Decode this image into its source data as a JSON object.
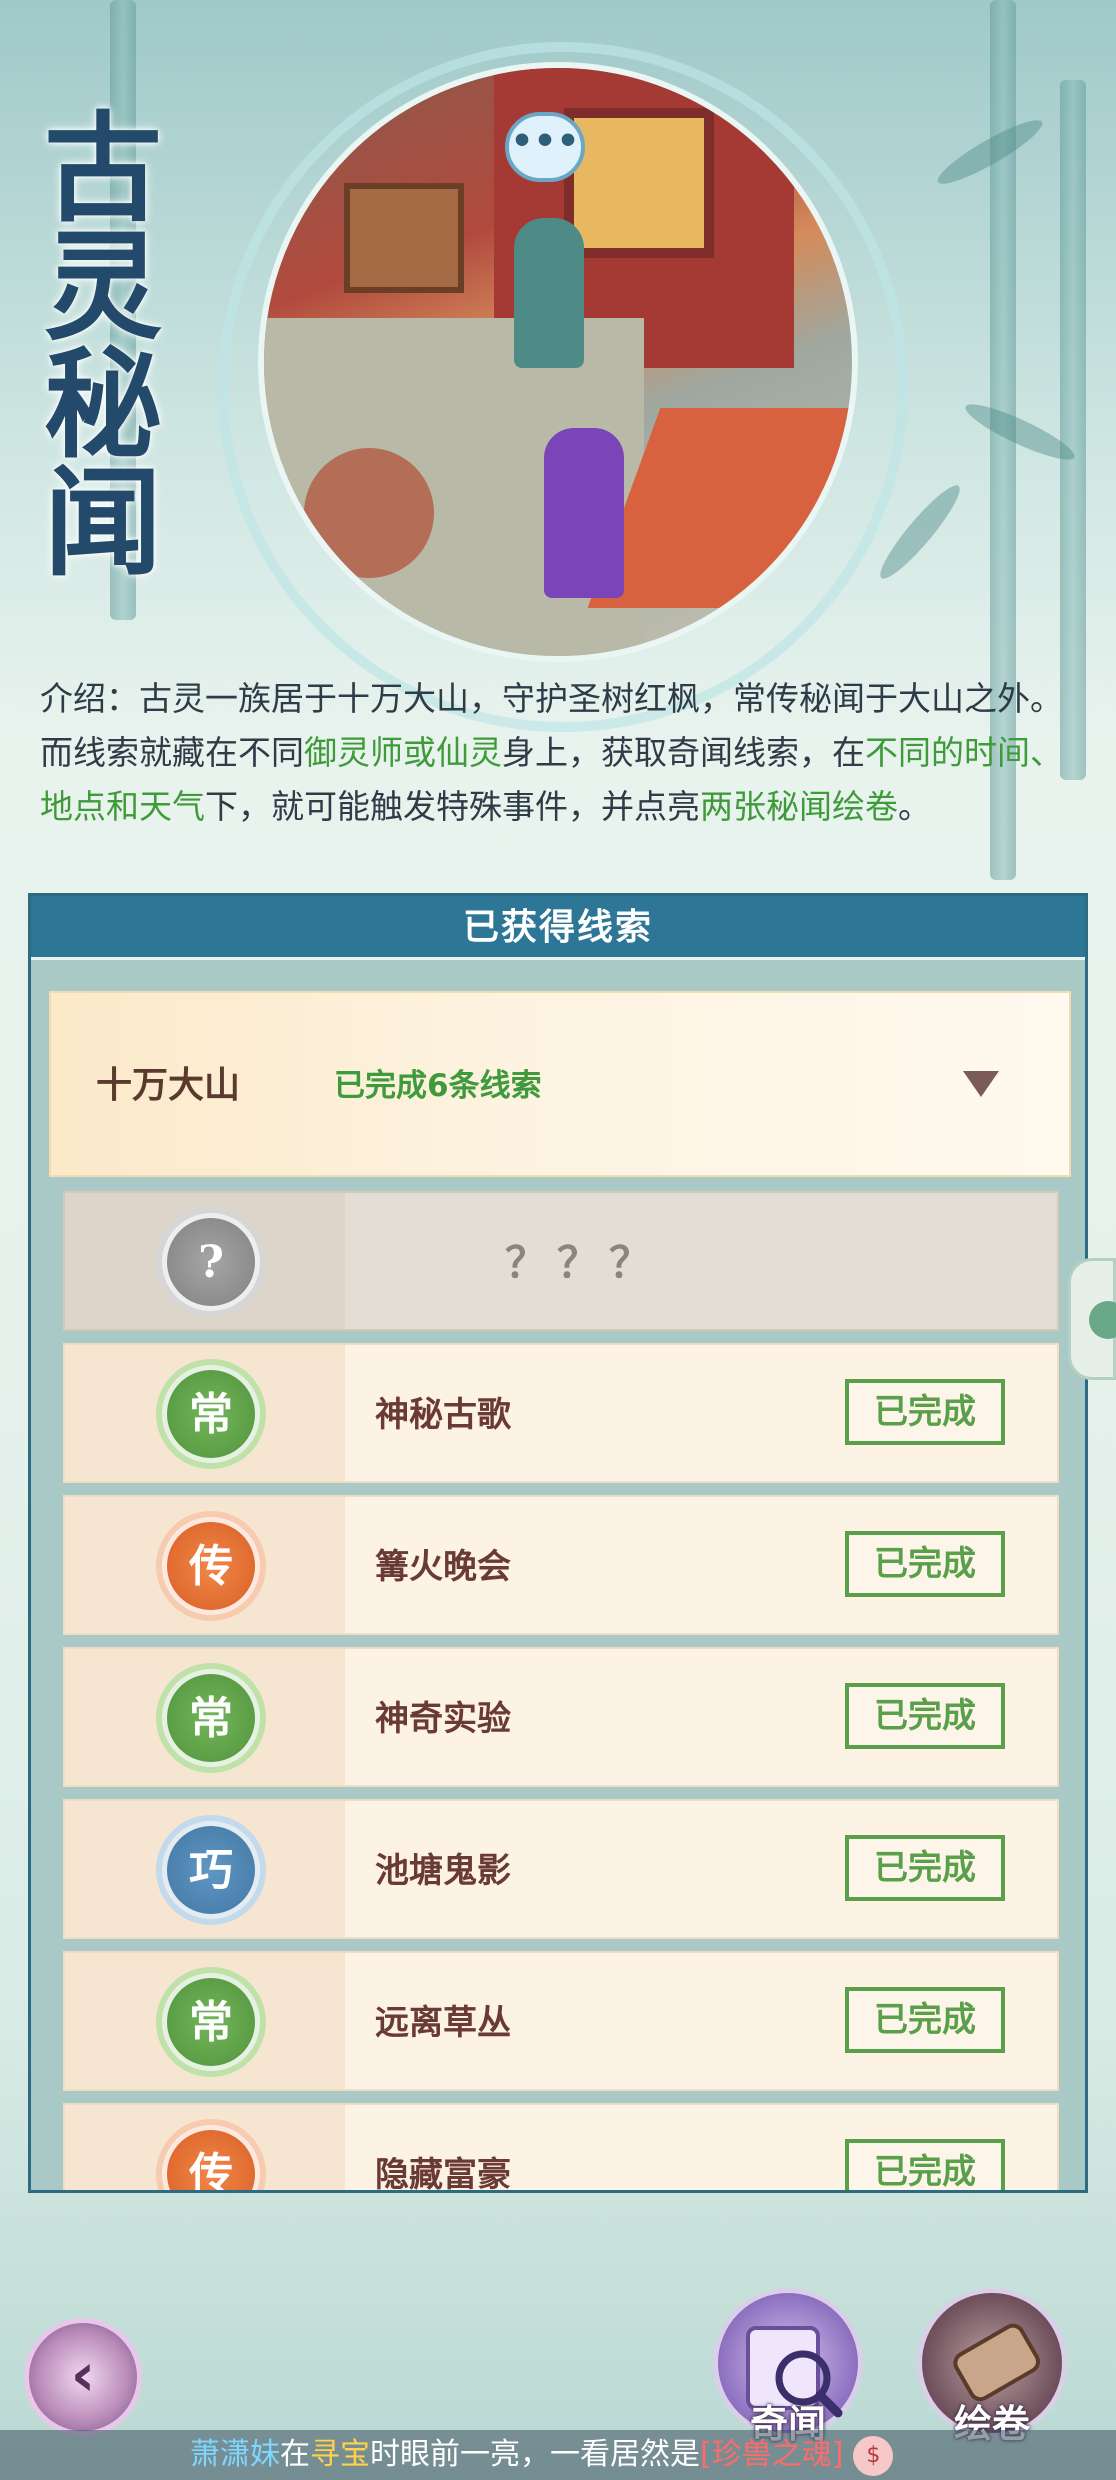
{
  "header": {
    "title": "古灵秘闻",
    "speech_icon": "•••"
  },
  "intro": {
    "label": "介绍：",
    "text_1": "古灵一族居于十万大山，守护圣树红枫，常传秘闻于大山之外。而线索就藏在不同",
    "highlight_1": "御灵师或仙灵",
    "text_2": "身上，获取奇闻线索，在",
    "highlight_2": "不同的时间、地点和天气",
    "text_3": "下，就可能触发特殊事件，并点亮",
    "highlight_3": "两张秘闻绘卷",
    "text_4": "。"
  },
  "panel": {
    "title": "已获得线索",
    "region": {
      "name": "十万大山",
      "status": "已完成6条线索"
    },
    "clues": [
      {
        "badge": "?",
        "name": "？？？",
        "status": "",
        "color": "grey"
      },
      {
        "badge": "常",
        "name": "神秘古歌",
        "status": "已完成",
        "color": "green"
      },
      {
        "badge": "传",
        "name": "篝火晚会",
        "status": "已完成",
        "color": "orange"
      },
      {
        "badge": "常",
        "name": "神奇实验",
        "status": "已完成",
        "color": "green"
      },
      {
        "badge": "巧",
        "name": "池塘鬼影",
        "status": "已完成",
        "color": "blue"
      },
      {
        "badge": "常",
        "name": "远离草丛",
        "status": "已完成",
        "color": "green"
      },
      {
        "badge": "传",
        "name": "隐藏富豪",
        "status": "已完成",
        "color": "orange"
      }
    ]
  },
  "footer": {
    "back_icon": "back-arrow-icon",
    "qiwen_label": "奇闻",
    "huijuan_label": "绘卷"
  },
  "ticker": {
    "name": "萧潇妹",
    "t1": "在",
    "keyword": "寻宝",
    "t2": "时眼前一亮，一看居然是",
    "item": "[珍兽之魂]"
  },
  "colors": {
    "accent": "#2e7696",
    "complete": "#5aa04b",
    "highlight": "#3f9a3a"
  }
}
